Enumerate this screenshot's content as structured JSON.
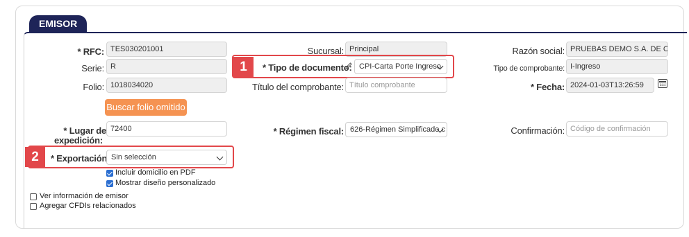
{
  "section": {
    "title": "EMISOR"
  },
  "labels": {
    "rfc": "* RFC:",
    "serie": "Serie:",
    "folio": "Folio:",
    "sucursal": "Sucursal:",
    "tipo_documento": "* Tipo de documento:",
    "titulo_comprobante": "Título del comprobante:",
    "razon_social": "Razón social:",
    "tipo_comprobante": "Tipo de comprobante:",
    "fecha": "* Fecha:",
    "lugar_expedicion_1": "* Lugar de",
    "lugar_expedicion_2": "expedición:",
    "regimen_fiscal": "* Régimen fiscal:",
    "confirmacion": "Confirmación:",
    "exportacion": "* Exportación:"
  },
  "fields": {
    "rfc": "TES030201001",
    "serie": "R",
    "folio": "1018034020",
    "sucursal": "Principal",
    "tipo_documento": "CPI-Carta Porte Ingreso",
    "titulo_comprobante_placeholder": "Título comprobante",
    "razon_social": "PRUEBAS DEMO S.A. DE C.V.",
    "tipo_comprobante": "I-Ingreso",
    "fecha": "2024-01-03T13:26:59",
    "lugar_expedicion": "72400",
    "regimen_fiscal": "626-Régimen Simplificado c",
    "confirmacion_placeholder": "Código de confirmación",
    "exportacion": "Sin selección"
  },
  "buttons": {
    "buscar_folio": "Buscar folio omitido"
  },
  "checkboxes": [
    {
      "label": "Incluir domicilio en PDF",
      "checked": true
    },
    {
      "label": "Mostrar diseño personalizado",
      "checked": true
    },
    {
      "label": "Ver información de emisor",
      "checked": false
    },
    {
      "label": "Agregar CFDIs relacionados",
      "checked": false
    }
  ],
  "callouts": [
    "1",
    "2"
  ],
  "colors": {
    "header": "#1e2458",
    "accent_button": "#f59352",
    "callout": "#e2474a",
    "checkbox": "#2c6fd1"
  }
}
